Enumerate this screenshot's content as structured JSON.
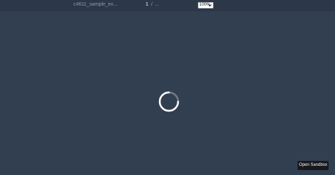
{
  "toolbar": {
    "document_title": "c4611_sample_ex...",
    "page_current": "1",
    "page_separator": "/",
    "page_total": "...",
    "zoom_value": "100%"
  },
  "loading": {
    "spinner_icon": "loading-spinner-icon"
  },
  "footer": {
    "open_sandbox_label": "Open Sandbox"
  },
  "colors": {
    "background": "#323f51",
    "toolbar": "#2c3848",
    "button": "#17191d"
  }
}
